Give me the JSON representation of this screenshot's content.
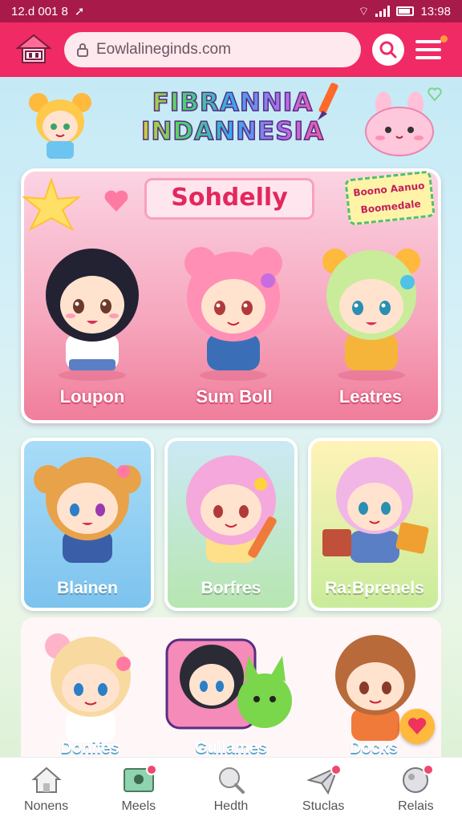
{
  "status_bar": {
    "time_left": "12.d 001 8",
    "time_right": "13:98"
  },
  "header": {
    "url": "Eowlalineginds.com"
  },
  "banner": {
    "title_line1": "FIBRANNIA",
    "title_line2": "INDANNESIA"
  },
  "featured": {
    "title": "Sohdelly",
    "badge_line1": "Boono Aanuo",
    "badge_line2": "Boomedale",
    "characters": [
      {
        "name": "Loupon",
        "hair": "#222233"
      },
      {
        "name": "Sum Boll",
        "hair": "#ff8fb4"
      },
      {
        "name": "Leatres",
        "hair": "#c9ec9a"
      }
    ]
  },
  "cards": [
    {
      "name": "Blainen",
      "bg": "#8fd0f3",
      "hair": "#e8a24a"
    },
    {
      "name": "Borfres",
      "bg": "#c5ecb0",
      "hair": "#f5a8dc"
    },
    {
      "name": "Ra:Bprenels",
      "bg": "#cfeea0",
      "hair": "#f2b6e6"
    }
  ],
  "row2": [
    {
      "name": "Donifes",
      "hair": "#f8d9a0"
    },
    {
      "name": "Gullames",
      "hair": "#2b2b36"
    },
    {
      "name": "Docks",
      "hair": "#b86a3a"
    }
  ],
  "nav": [
    {
      "label": "Nonens",
      "badge": false
    },
    {
      "label": "Meels",
      "badge": true
    },
    {
      "label": "Hedth",
      "badge": false
    },
    {
      "label": "Stuclas",
      "badge": true
    },
    {
      "label": "Relais",
      "badge": true
    }
  ],
  "colors": {
    "accent": "#f02a64",
    "status": "#a81a4a"
  }
}
